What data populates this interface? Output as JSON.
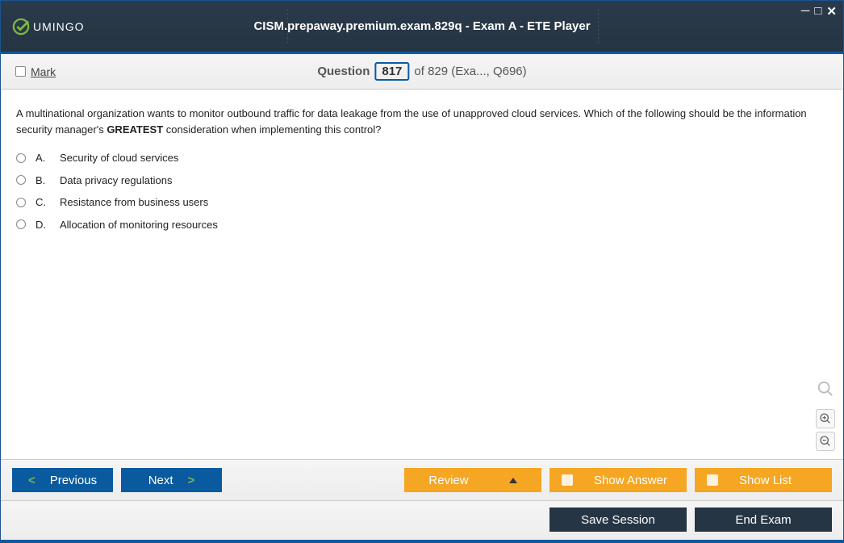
{
  "header": {
    "logo_text": "UMINGO",
    "title": "CISM.prepaway.premium.exam.829q - Exam A - ETE Player"
  },
  "questionBar": {
    "mark_label": "Mark",
    "q_word": "Question",
    "q_num": "817",
    "q_of": " of 829 (Exa..., Q696)"
  },
  "question": {
    "text_before": "A multinational organization wants to monitor outbound traffic for data leakage from the use of unapproved cloud services. Which of the following should be the information security manager's ",
    "emph": "GREATEST",
    "text_after": " consideration when implementing this control?",
    "options": [
      {
        "letter": "A.",
        "text": "Security of cloud services"
      },
      {
        "letter": "B.",
        "text": "Data privacy regulations"
      },
      {
        "letter": "C.",
        "text": "Resistance from business users"
      },
      {
        "letter": "D.",
        "text": "Allocation of monitoring resources"
      }
    ]
  },
  "buttons": {
    "previous": "Previous",
    "next": "Next",
    "review": "Review",
    "show_answer": "Show Answer",
    "show_list": "Show List",
    "save_session": "Save Session",
    "end_exam": "End Exam"
  }
}
